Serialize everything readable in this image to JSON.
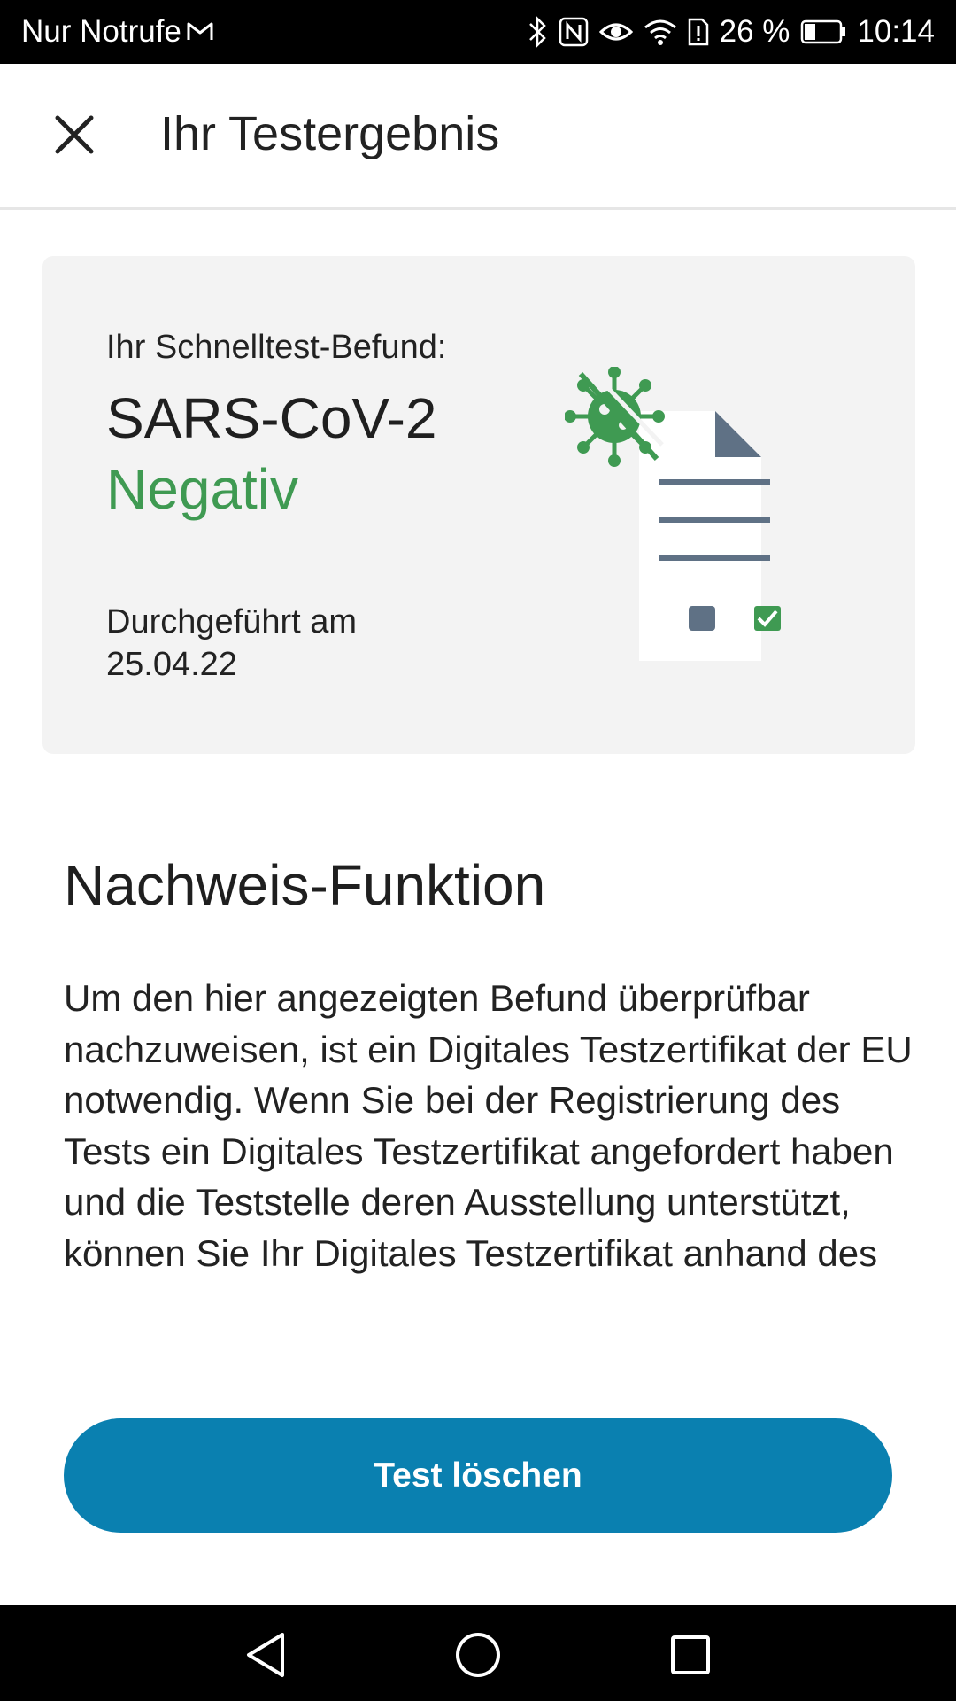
{
  "status_bar": {
    "carrier": "Nur Notrufe",
    "battery_percent": "26 %",
    "time": "10:14",
    "icons": [
      "gmail-icon",
      "bluetooth-icon",
      "nfc-icon",
      "eye-icon",
      "wifi-icon",
      "alert-icon",
      "battery-icon"
    ]
  },
  "toolbar": {
    "title": "Ihr Testergebnis",
    "close_icon": "close-icon"
  },
  "result_card": {
    "label": "Ihr Schnelltest-Befund:",
    "pathogen": "SARS-CoV-2",
    "result": "Negativ",
    "date_label": "Durchgeführt am",
    "date": "25.04.22",
    "illustration": "virus-document-icon",
    "colors": {
      "result": "#3f9a52",
      "card_bg": "#f3f3f3"
    }
  },
  "proof_section": {
    "title": "Nachweis-Funktion",
    "body": "Um den hier angezeigten Befund überprüfbar nachzuweisen, ist ein Digitales Testzertifikat der EU notwendig. Wenn Sie bei der Registrierung des Tests ein Digitales Testzertifikat angefordert haben und die Teststelle deren Ausstellung unterstützt, können Sie Ihr Digitales Testzertifikat anhand des"
  },
  "actions": {
    "delete_label": "Test löschen",
    "delete_color": "#0a80b0"
  },
  "nav_bar": {
    "buttons": [
      "back-icon",
      "home-icon",
      "recents-icon"
    ]
  }
}
